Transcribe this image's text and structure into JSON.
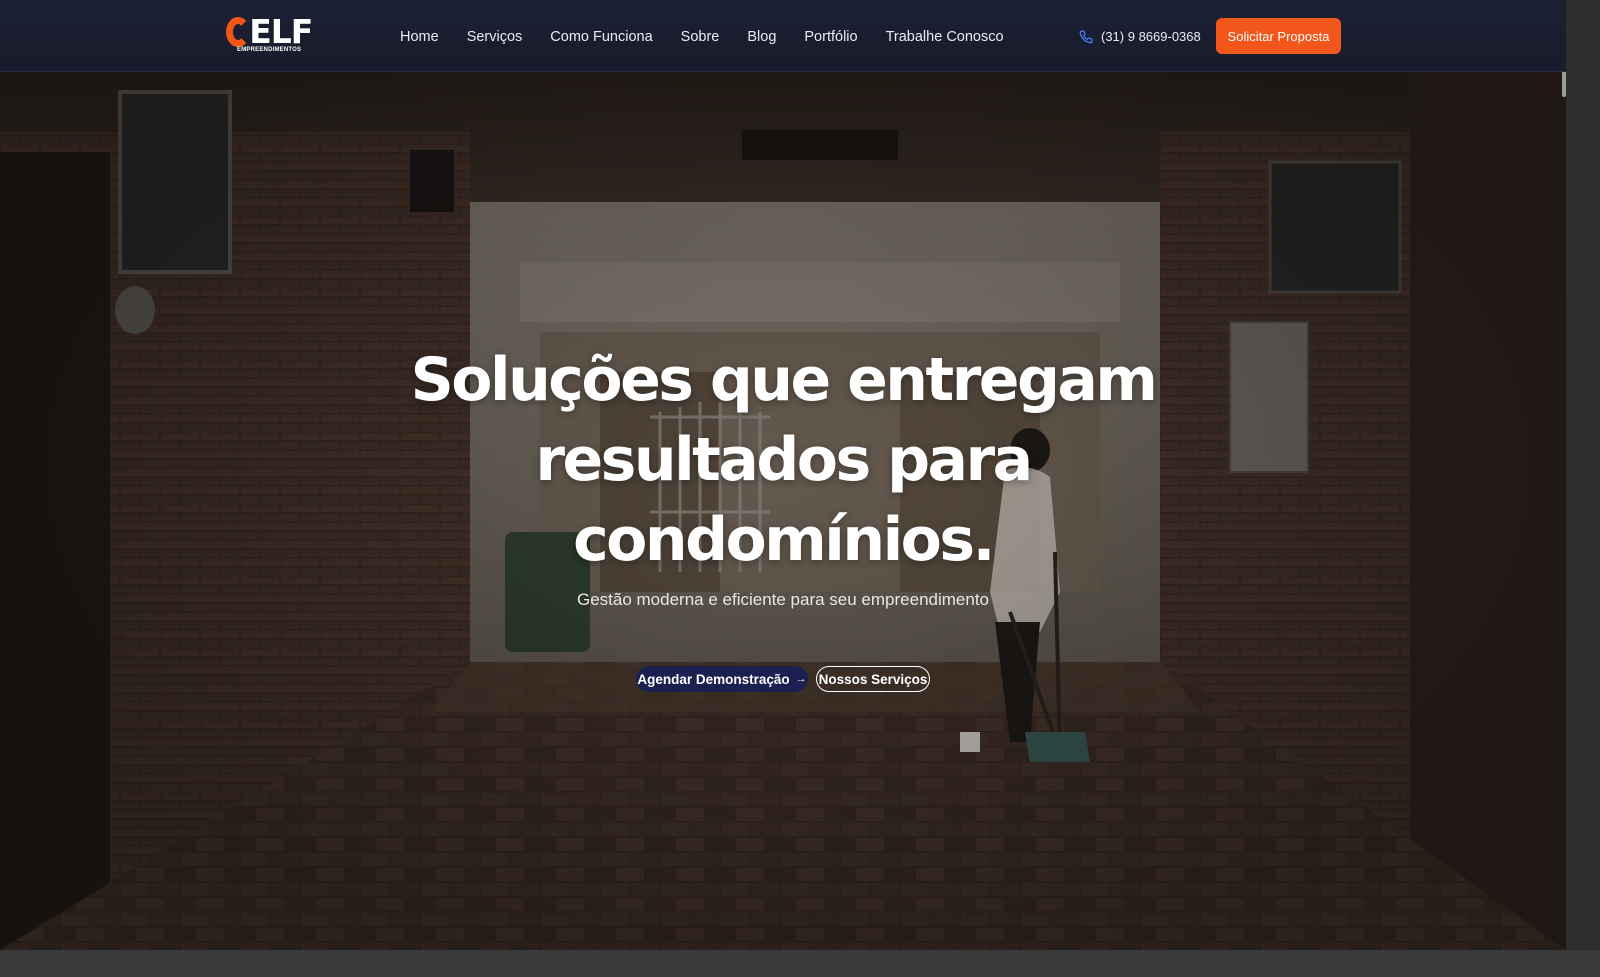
{
  "header": {
    "logo": {
      "word": "CELF",
      "subtitle": "EMPREENDIMENTOS",
      "icon": "celf-logo"
    },
    "nav": [
      {
        "label": "Home"
      },
      {
        "label": "Serviços"
      },
      {
        "label": "Como Funciona"
      },
      {
        "label": "Sobre"
      },
      {
        "label": "Blog"
      },
      {
        "label": "Portfólio"
      },
      {
        "label": "Trabalhe Conosco"
      }
    ],
    "phone": {
      "icon": "phone-icon",
      "text": "(31) 9 8669-0368"
    },
    "cta_label": "Solicitar Proposta"
  },
  "hero": {
    "title_line1": "Soluções que entregam",
    "title_line2": "resultados para",
    "title_line3": "condomínios.",
    "subtitle": "Gestão moderna e eficiente para seu empreendimento",
    "primary_button": "Agendar Demonstração",
    "primary_button_icon": "arrow-right-icon",
    "secondary_button": "Nossos Serviços"
  },
  "colors": {
    "header_bg": "#1b2033",
    "accent": "#f2561a",
    "primary_button": "#1a2150",
    "text": "#ffffff"
  }
}
